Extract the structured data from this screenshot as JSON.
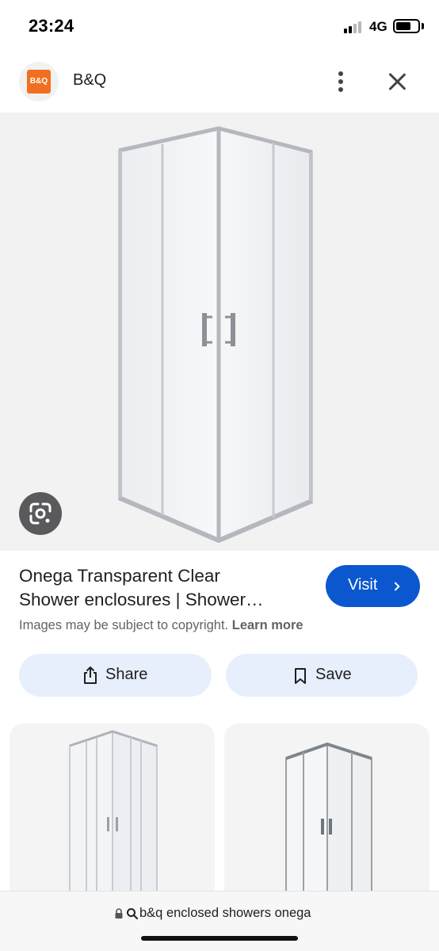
{
  "status_bar": {
    "time": "23:24",
    "network": "4G",
    "battery_level": 0.7,
    "signal_bars_active": 2
  },
  "header": {
    "logo_text": "B&Q",
    "site_name": "B&Q",
    "logo_color": "#f26f21",
    "icons": [
      "more-vertical-icon",
      "close-icon"
    ]
  },
  "image_viewer": {
    "lens_icon": "google-lens-icon"
  },
  "result": {
    "title_line1": "Onega Transparent Clear",
    "title_line2": "Shower enclosures | Shower…",
    "visit_label": "Visit",
    "copyright_text": "Images may be subject to copyright.",
    "learn_more": "Learn more"
  },
  "actions": {
    "share_label": "Share",
    "save_label": "Save"
  },
  "colors": {
    "accent": "#0b57d0",
    "action_bg": "#e7effc"
  },
  "bottom_bar": {
    "url": "b&q enclosed showers onega"
  }
}
